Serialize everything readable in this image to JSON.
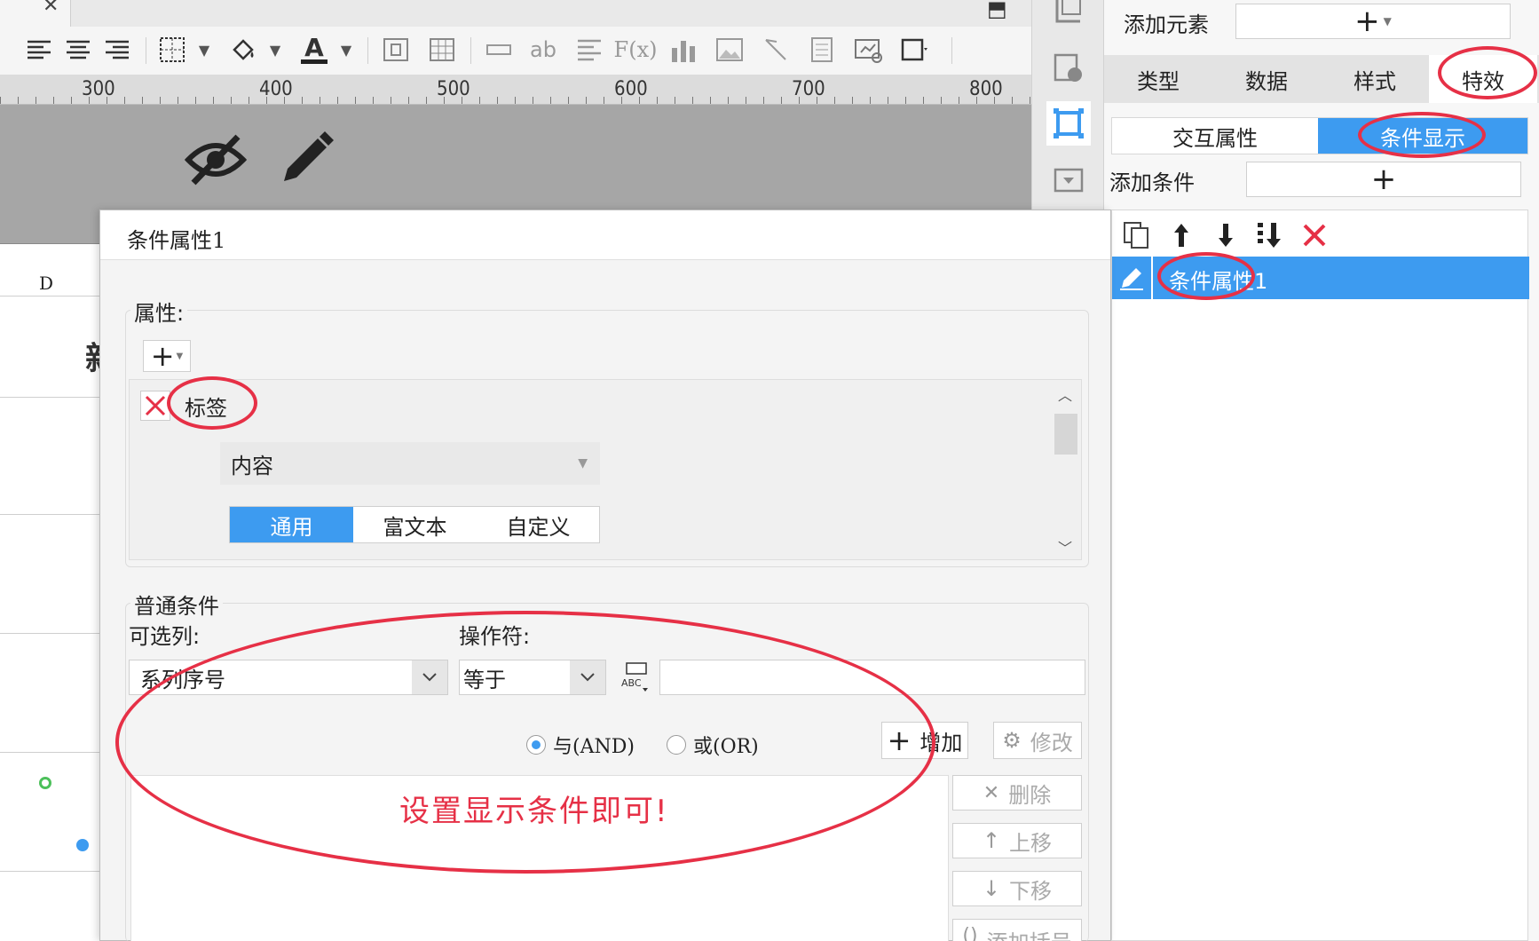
{
  "toolbar": {
    "icons": [
      "close-icon",
      "align-left-icon",
      "align-center-icon",
      "align-right-icon",
      "border-icon",
      "fill-color-icon",
      "font-color-icon",
      "merge-cell-icon",
      "grid-icon",
      "field-icon",
      "text-icon",
      "list-icon",
      "formula-icon",
      "bar-chart-icon",
      "image-icon",
      "slash-icon",
      "page-icon",
      "report-icon",
      "frame-icon"
    ]
  },
  "ruler": {
    "labels": [
      "300",
      "400",
      "500",
      "600",
      "700",
      "800"
    ]
  },
  "sheet": {
    "column_header": "D",
    "cell_fragment": "新"
  },
  "right_panel": {
    "add_element_label": "添加元素",
    "main_tabs": [
      "类型",
      "数据",
      "样式",
      "特效"
    ],
    "sub_tabs": [
      "交互属性",
      "条件显示"
    ],
    "add_condition_label": "添加条件",
    "list_item": "条件属性1"
  },
  "dialog": {
    "title": "条件属性1",
    "attributes_legend": "属性:",
    "attribute_item": "标签",
    "content_select": "内容",
    "content_tabs": [
      "通用",
      "富文本",
      "自定义"
    ],
    "normal_conditions_legend": "普通条件",
    "column_label": "可选列:",
    "operator_label": "操作符:",
    "column_value": "系列序号",
    "operator_value": "等于",
    "value_input": "",
    "radio_and": "与(AND)",
    "radio_or": "或(OR)",
    "add_button": "增加",
    "modify_button": "修改",
    "delete_button": "删除",
    "move_up_button": "上移",
    "move_down_button": "下移",
    "add_bracket_button": "添加括号"
  },
  "annotation": {
    "text": "设置显示条件即可!"
  },
  "colors": {
    "accent": "#3d9bf0",
    "annotation": "#e63046",
    "delete": "#e63046"
  }
}
